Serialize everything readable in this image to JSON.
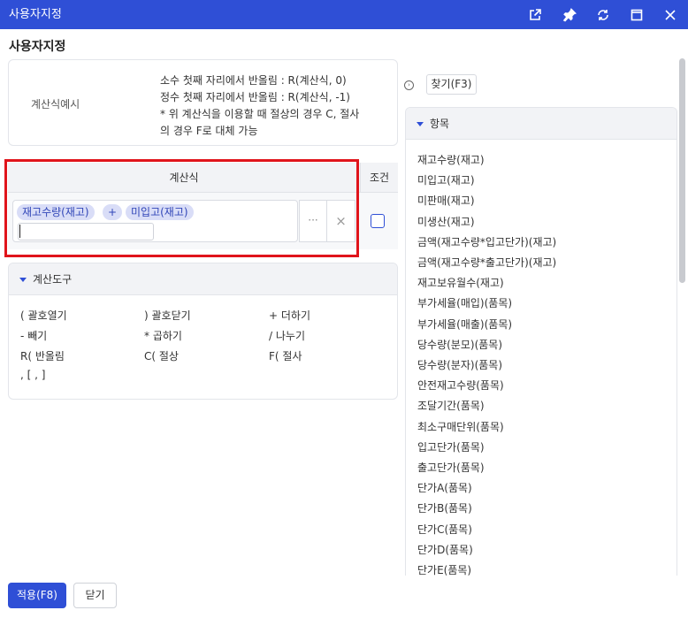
{
  "window": {
    "title": "사용자지정"
  },
  "page_title": "사용자지정",
  "example": {
    "label": "계산식예시",
    "lines": [
      "소수 첫째 자리에서 반올림 : R(계산식, 0)",
      "정수 첫째 자리에서 반올림 : R(계산식, -1)",
      "* 위 계산식을 이용할 때 절상의 경우 C, 절사",
      "의 경우 F로 대체 가능"
    ]
  },
  "formula": {
    "header": "계산식",
    "condition_header": "조건",
    "tags": [
      "재고수량(재고)",
      "+",
      "미입고(재고)"
    ],
    "input_value": "",
    "more_label": "···",
    "clear_label": "×"
  },
  "tools": {
    "header": "계산도구",
    "items": [
      "( 괄호열기",
      ") 괄호닫기",
      "+ 더하기",
      "- 빼기",
      "* 곱하기",
      "/ 나누기",
      "R( 반올림",
      "C( 절상",
      "F( 절사",
      ", [ , ]"
    ]
  },
  "find_button": "찾기(F3)",
  "items_panel": {
    "header": "항목",
    "items": [
      "재고수량(재고)",
      "미입고(재고)",
      "미판매(재고)",
      "미생산(재고)",
      "금액(재고수량*입고단가)(재고)",
      "금액(재고수량*출고단가)(재고)",
      "재고보유월수(재고)",
      "부가세율(매입)(품목)",
      "부가세율(매출)(품목)",
      "당수량(분모)(품목)",
      "당수량(분자)(품목)",
      "안전재고수량(품목)",
      "조달기간(품목)",
      "최소구매단위(품목)",
      "입고단가(품목)",
      "출고단가(품목)",
      "단가A(품목)",
      "단가B(품목)",
      "단가C(품목)",
      "단가D(품목)",
      "단가E(품목)"
    ]
  },
  "footer": {
    "apply": "적용(F8)",
    "close": "닫기"
  },
  "colors": {
    "accent": "#2f4fd6",
    "highlight_border": "#e0141b",
    "tag_bg": "#d9ddf7"
  }
}
